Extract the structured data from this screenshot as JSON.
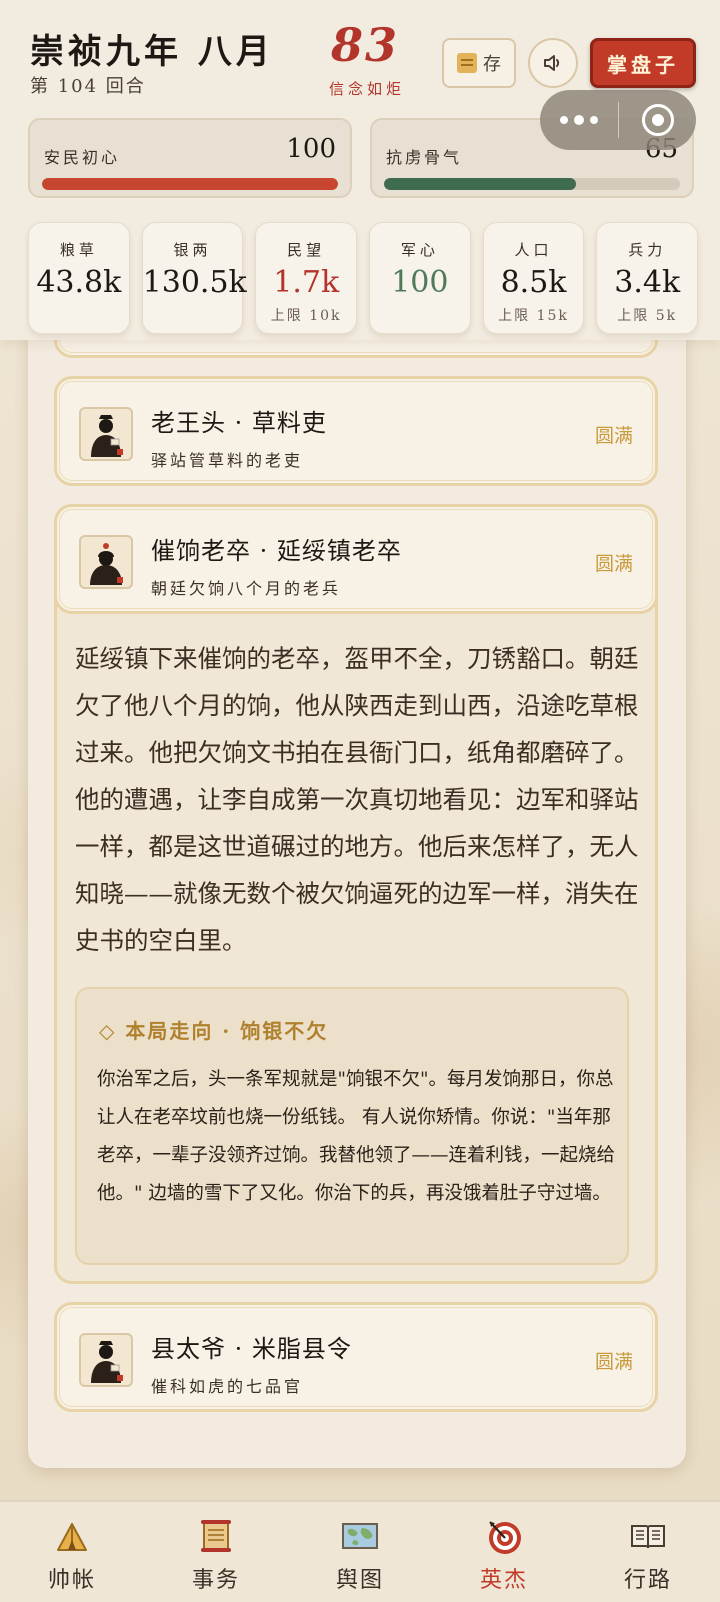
{
  "header": {
    "era": "崇祯九年 八月",
    "round": "第 104 回合",
    "faith_value": "83",
    "faith_label": "信念如炬",
    "save_label": "存",
    "ledger_label": "掌盘子"
  },
  "meters": [
    {
      "label": "安民初心",
      "value": "100",
      "fraction": 1.0,
      "color": "#c8452f"
    },
    {
      "label": "抗虏骨气",
      "value": "65",
      "fraction": 0.65,
      "color": "#3f6b4e"
    }
  ],
  "stats": [
    {
      "label": "粮草",
      "value": "43.8k",
      "sub": "",
      "color": "#1e1814"
    },
    {
      "label": "银两",
      "value": "130.5k",
      "sub": "",
      "color": "#1e1814"
    },
    {
      "label": "民望",
      "value": "1.7k",
      "sub": "上限 10k",
      "color": "#b2342a"
    },
    {
      "label": "军心",
      "value": "100",
      "sub": "",
      "color": "#4f7a5a"
    },
    {
      "label": "人口",
      "value": "8.5k",
      "sub": "上限 15k",
      "color": "#1e1814"
    },
    {
      "label": "兵力",
      "value": "3.4k",
      "sub": "上限 5k",
      "color": "#1e1814"
    }
  ],
  "heroes": [
    {
      "name": "老王头 · 草料吏",
      "desc": "驿站管草料的老吏",
      "status": "圆满"
    },
    {
      "name": "催饷老卒 · 延绥镇老卒",
      "desc": "朝廷欠饷八个月的老兵",
      "status": "圆满"
    },
    {
      "name": "县太爷 · 米脂县令",
      "desc": "催科如虎的七品官",
      "status": "圆满"
    }
  ],
  "story": "延绥镇下来催饷的老卒，盔甲不全，刀锈豁口。朝廷欠了他八个月的饷，他从陕西走到山西，沿途吃草根过来。他把欠饷文书拍在县衙门口，纸角都磨碎了。 他的遭遇，让李自成第一次真切地看见：边军和驿站一样，都是这世道碾过的地方。他后来怎样了，无人知晓——就像无数个被欠饷逼死的边军一样，消失在史书的空白里。",
  "fate": {
    "title": "◇ 本局走向 · 饷银不欠",
    "text": "你治军之后，头一条军规就是\"饷银不欠\"。每月发饷那日，你总让人在老卒坟前也烧一份纸钱。 有人说你矫情。你说：\"当年那老卒，一辈子没领齐过饷。我替他领了——连着利钱，一起烧给他。\" 边墙的雪下了又化。你治下的兵，再没饿着肚子守过墙。"
  },
  "nav": [
    {
      "label": "帅帐",
      "icon": "tent-icon"
    },
    {
      "label": "事务",
      "icon": "scroll-icon"
    },
    {
      "label": "舆图",
      "icon": "map-icon"
    },
    {
      "label": "英杰",
      "icon": "target-icon",
      "active": true
    },
    {
      "label": "行路",
      "icon": "book-icon"
    }
  ]
}
